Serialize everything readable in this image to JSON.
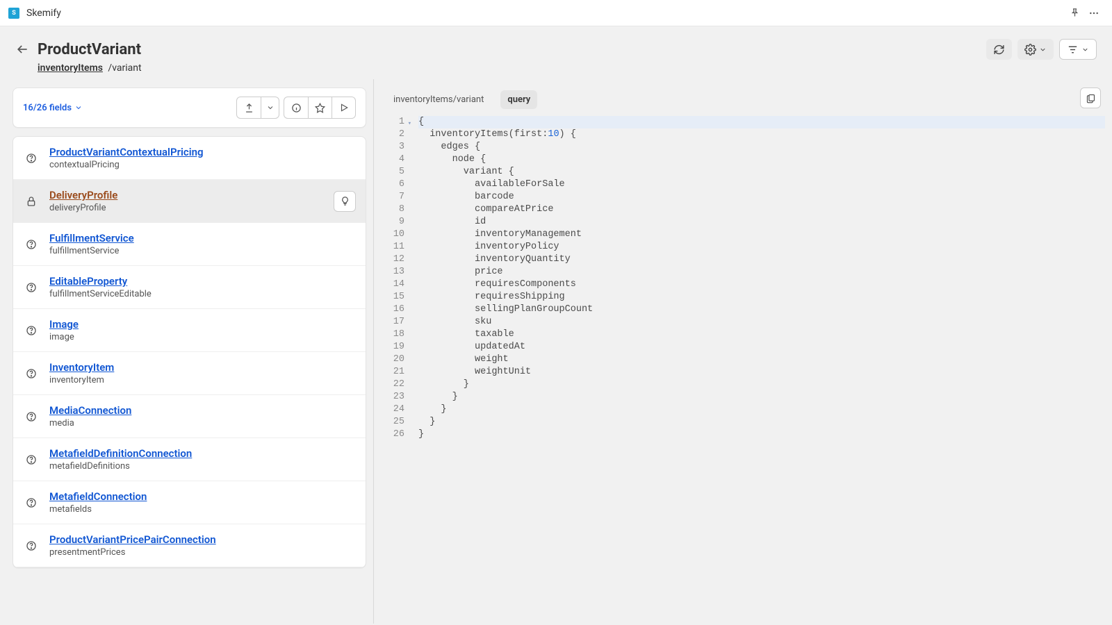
{
  "app": {
    "name": "Skemify"
  },
  "header": {
    "title": "ProductVariant",
    "breadcrumb_link": "inventoryItems",
    "breadcrumb_tail": "/variant"
  },
  "fields_bar": {
    "count_label": "16/26 fields"
  },
  "fields": [
    {
      "type": "ProductVariantContextualPricing",
      "name": "contextualPricing",
      "icon": "help",
      "selected": false
    },
    {
      "type": "DeliveryProfile",
      "name": "deliveryProfile",
      "icon": "lock",
      "selected": true
    },
    {
      "type": "FulfillmentService",
      "name": "fulfillmentService",
      "icon": "help",
      "selected": false
    },
    {
      "type": "EditableProperty",
      "name": "fulfillmentServiceEditable",
      "icon": "help",
      "selected": false
    },
    {
      "type": "Image",
      "name": "image",
      "icon": "help",
      "selected": false
    },
    {
      "type": "InventoryItem",
      "name": "inventoryItem",
      "icon": "help",
      "selected": false
    },
    {
      "type": "MediaConnection",
      "name": "media",
      "icon": "help",
      "selected": false
    },
    {
      "type": "MetafieldDefinitionConnection",
      "name": "metafieldDefinitions",
      "icon": "help",
      "selected": false
    },
    {
      "type": "MetafieldConnection",
      "name": "metafields",
      "icon": "help",
      "selected": false
    },
    {
      "type": "ProductVariantPricePairConnection",
      "name": "presentmentPrices",
      "icon": "help",
      "selected": false
    }
  ],
  "editor": {
    "tab_path": "inventoryItems/variant",
    "tab_query": "query",
    "lines": [
      {
        "n": 1,
        "t": "{",
        "hl": true,
        "fold": true
      },
      {
        "n": 2,
        "t": "  inventoryItems(first:",
        "numTok": "10",
        "tail": ") {"
      },
      {
        "n": 3,
        "t": "    edges {"
      },
      {
        "n": 4,
        "t": "      node {"
      },
      {
        "n": 5,
        "t": "        variant {"
      },
      {
        "n": 6,
        "t": "          availableForSale"
      },
      {
        "n": 7,
        "t": "          barcode"
      },
      {
        "n": 8,
        "t": "          compareAtPrice"
      },
      {
        "n": 9,
        "t": "          id"
      },
      {
        "n": 10,
        "t": "          inventoryManagement"
      },
      {
        "n": 11,
        "t": "          inventoryPolicy"
      },
      {
        "n": 12,
        "t": "          inventoryQuantity"
      },
      {
        "n": 13,
        "t": "          price"
      },
      {
        "n": 14,
        "t": "          requiresComponents"
      },
      {
        "n": 15,
        "t": "          requiresShipping"
      },
      {
        "n": 16,
        "t": "          sellingPlanGroupCount"
      },
      {
        "n": 17,
        "t": "          sku"
      },
      {
        "n": 18,
        "t": "          taxable"
      },
      {
        "n": 19,
        "t": "          updatedAt"
      },
      {
        "n": 20,
        "t": "          weight"
      },
      {
        "n": 21,
        "t": "          weightUnit"
      },
      {
        "n": 22,
        "t": "        }"
      },
      {
        "n": 23,
        "t": "      }"
      },
      {
        "n": 24,
        "t": "    }"
      },
      {
        "n": 25,
        "t": "  }"
      },
      {
        "n": 26,
        "t": "}"
      }
    ]
  }
}
